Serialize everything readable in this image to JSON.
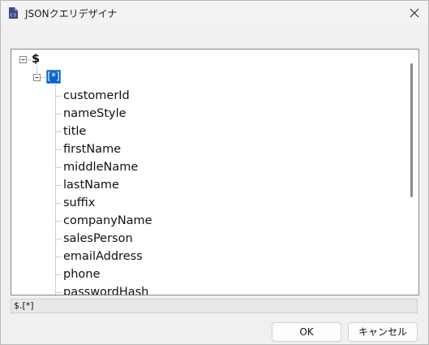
{
  "window": {
    "title": "JSONクエリデザイナ",
    "app_icon": "json-doc-icon",
    "close_icon": "close-icon"
  },
  "tree": {
    "root_label": "$",
    "array_label": "[*]",
    "items": [
      "customerId",
      "nameStyle",
      "title",
      "firstName",
      "middleName",
      "lastName",
      "suffix",
      "companyName",
      "salesPerson",
      "emailAddress",
      "phone",
      "passwordHash"
    ]
  },
  "path_bar": {
    "value": "$.[*]"
  },
  "buttons": {
    "ok_label": "OK",
    "cancel_label": "キャンセル"
  },
  "colors": {
    "selection": "#0a63c8",
    "window_bg": "#f0f0f0",
    "tree_bg": "#ffffff"
  }
}
